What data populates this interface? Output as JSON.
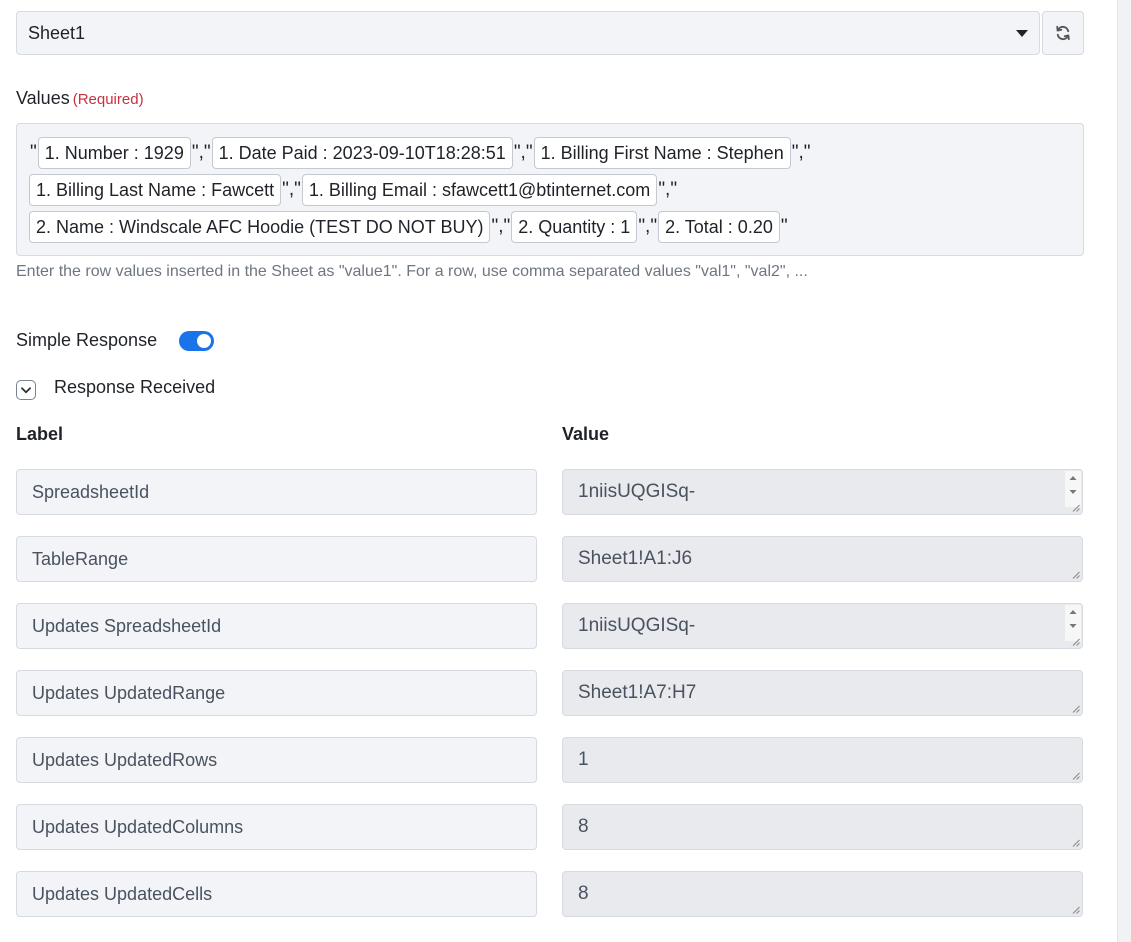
{
  "sheet_select": {
    "selected": "Sheet1",
    "caret_icon": "caret-down-icon",
    "refresh_icon": "refresh-icon"
  },
  "values_field": {
    "label": "Values",
    "required": "(Required)",
    "lines": [
      [
        {
          "kind": "sep",
          "text": "\""
        },
        {
          "kind": "chip",
          "text": "1. Number : 1929"
        },
        {
          "kind": "sep",
          "text": "\",\""
        },
        {
          "kind": "chip",
          "text": "1. Date Paid : 2023-09-10T18:28:51"
        },
        {
          "kind": "sep",
          "text": "\",\""
        },
        {
          "kind": "chip",
          "text": "1. Billing First Name : Stephen"
        },
        {
          "kind": "sep",
          "text": "\",\""
        }
      ],
      [
        {
          "kind": "chip",
          "text": "1. Billing Last Name : Fawcett"
        },
        {
          "kind": "sep",
          "text": "\",\""
        },
        {
          "kind": "chip",
          "text": "1. Billing Email : sfawcett1@btinternet.com"
        },
        {
          "kind": "sep",
          "text": "\",\""
        }
      ],
      [
        {
          "kind": "chip",
          "text": "2. Name : Windscale AFC Hoodie (TEST DO NOT BUY)"
        },
        {
          "kind": "sep",
          "text": "\",\""
        },
        {
          "kind": "chip",
          "text": "2. Quantity : 1"
        },
        {
          "kind": "sep",
          "text": "\",\""
        },
        {
          "kind": "chip",
          "text": "2. Total : 0.20"
        },
        {
          "kind": "sep",
          "text": "\""
        }
      ]
    ],
    "help": "Enter the row values inserted in the Sheet as \"value1\". For a row, use comma separated values \"val1\", \"val2\", ..."
  },
  "simple_response": {
    "label": "Simple Response",
    "enabled": true,
    "accent": "#1a73e8"
  },
  "response_received": {
    "label": "Response Received",
    "toggle_icon": "chevron-down-icon",
    "label_header": "Label",
    "value_header": "Value",
    "rows": [
      {
        "label": "SpreadsheetId",
        "value": "1niisUQGISq-",
        "spinner": true
      },
      {
        "label": "TableRange",
        "value": "Sheet1!A1:J6",
        "spinner": false
      },
      {
        "label": "Updates SpreadsheetId",
        "value": "1niisUQGISq-",
        "spinner": true
      },
      {
        "label": "Updates UpdatedRange",
        "value": "Sheet1!A7:H7",
        "spinner": false
      },
      {
        "label": "Updates UpdatedRows",
        "value": "1",
        "spinner": false
      },
      {
        "label": "Updates UpdatedColumns",
        "value": "8",
        "spinner": false
      },
      {
        "label": "Updates UpdatedCells",
        "value": "8",
        "spinner": false
      }
    ]
  }
}
